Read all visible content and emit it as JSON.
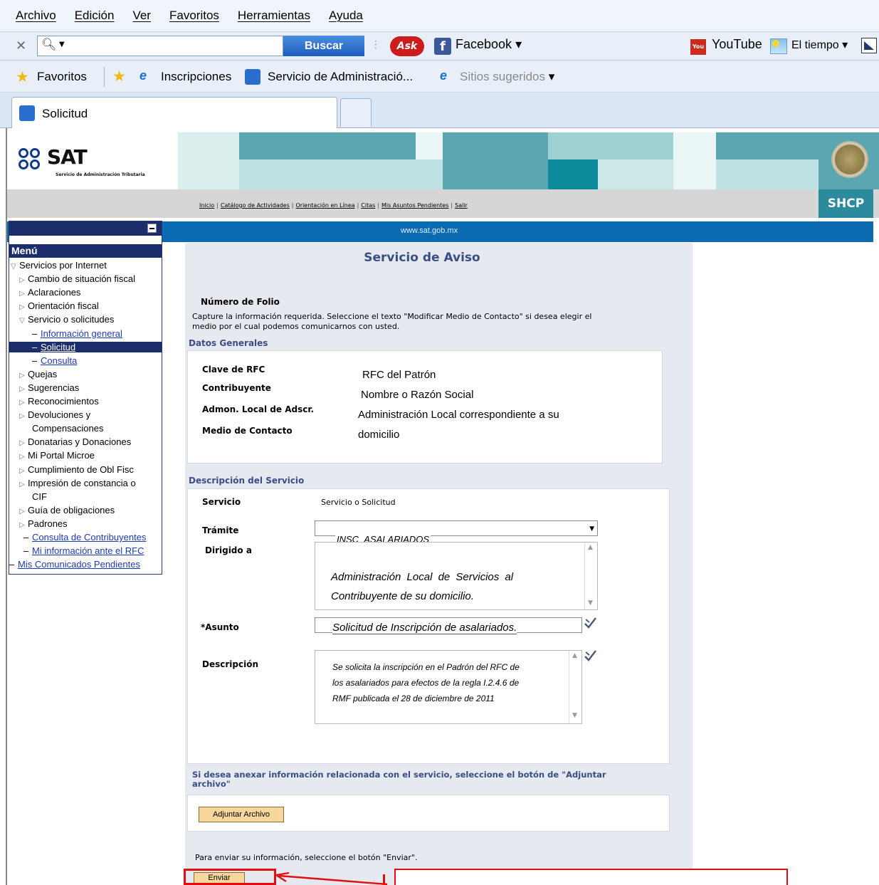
{
  "browser": {
    "menu": [
      "Archivo",
      "Edición",
      "Ver",
      "Favoritos",
      "Herramientas",
      "Ayuda"
    ],
    "search_button": "Buscar",
    "toolbar_items": {
      "facebook": "Facebook",
      "youtube": "YouTube",
      "weather": "El tiempo"
    },
    "favorites": {
      "label": "Favoritos",
      "items": [
        "Inscripciones",
        "Servicio de Administració...",
        "Sitios sugeridos"
      ]
    },
    "tab_title": "Solicitud"
  },
  "header": {
    "logo_text": "SAT",
    "logo_subtitle": "Servicio de Administración Tributaria",
    "shcp": "SHCP",
    "nav_links": [
      "Inicio",
      "Catálogo de Actividades",
      "Orientación en Línea",
      "Citas",
      "Mis Asuntos Pendientes",
      "Salir"
    ],
    "url_text": "www.sat.gob.mx"
  },
  "sidebar": {
    "menu_title": "Menú",
    "items": [
      {
        "label": "Servicios por Internet",
        "type": "open"
      },
      {
        "label": "Cambio de situación fiscal",
        "type": "closed"
      },
      {
        "label": "Aclaraciones",
        "type": "closed"
      },
      {
        "label": "Orientación fiscal",
        "type": "closed"
      },
      {
        "label": "Servicio o solicitudes",
        "type": "open"
      },
      {
        "label": "Información general",
        "type": "link"
      },
      {
        "label": "Solicitud",
        "type": "active"
      },
      {
        "label": "Consulta",
        "type": "link"
      },
      {
        "label": "Quejas",
        "type": "closed"
      },
      {
        "label": "Sugerencias",
        "type": "closed"
      },
      {
        "label": "Reconocimientos",
        "type": "closed"
      },
      {
        "label": "Devoluciones y",
        "type": "closed"
      },
      {
        "label": "Compensaciones",
        "type": "cont"
      },
      {
        "label": "Donatarias y Donaciones",
        "type": "closed"
      },
      {
        "label": "Mi Portal Microe",
        "type": "closed"
      },
      {
        "label": "Cumplimiento de Obl Fisc",
        "type": "closed"
      },
      {
        "label": "Impresión de constancia o",
        "type": "closed"
      },
      {
        "label": "CIF",
        "type": "cont"
      },
      {
        "label": "Guía de obligaciones",
        "type": "closed"
      },
      {
        "label": "Padrones",
        "type": "closed"
      },
      {
        "label": "Consulta de Contribuyentes",
        "type": "link"
      },
      {
        "label": "Mi información ante el RFC",
        "type": "link"
      },
      {
        "label": "Mis Comunicados Pendientes",
        "type": "toplink"
      }
    ]
  },
  "main": {
    "title": "Servicio de Aviso",
    "folio_label": "Número de Folio",
    "instructions_1": "Capture la información requerida. Seleccione el texto \"Modificar Medio de Contacto\" si desea elegir el",
    "instructions_2": "medio por el cual podemos comunicarnos con usted.",
    "datos_generales": "Datos Generales",
    "fields": {
      "rfc_label": "Clave de RFC",
      "rfc_value": "RFC del Patrón",
      "contrib_label": "Contribuyente",
      "contrib_value": "Nombre o Razón Social",
      "admon_label": "Admon. Local de Adscr.",
      "admon_value_1": "Administración Local  correspondiente a su",
      "admon_value_2": "domicilio",
      "medio_label": "Medio de Contacto"
    },
    "descripcion_servicio": "Descripción del Servicio",
    "servicio_label": "Servicio",
    "servicio_value": "Servicio o Solicitud",
    "tramite_label": "Trámite",
    "tramite_value": "INSC_ASALARIADOS",
    "dirigido_label": "Dirigido a",
    "dirigido_value_1": "Administración  Local  de  Servicios  al",
    "dirigido_value_2": "Contribuyente de su domicilio.",
    "asunto_label": "*Asunto",
    "asunto_value": "Solicitud de Inscripción de asalariados.",
    "descripcion_label": "Descripción",
    "descripcion_value_1": "Se solicita la inscripción en el Padrón del RFC de",
    "descripcion_value_2": "los asalariados para efectos de la regla I.2.4.6 de",
    "descripcion_value_3": "RMF publicada el 28 de diciembre de 2011",
    "anexar_1": "Si desea anexar información relacionada con el servicio, seleccione el botón de \"Adjuntar",
    "anexar_2": "archivo\"",
    "adjuntar_button": "Adjuntar Archivo",
    "enviar_text": "Para enviar su información, seleccione el botón \"Enviar\".",
    "enviar_button": "Enviar"
  },
  "colors": {
    "accent_blue": "#0b6bb1",
    "teal": "#5fb3bd",
    "shcp_bg": "#2b8a9c",
    "menu_header": "#1c2d6b",
    "annotation_red": "#e01010"
  }
}
